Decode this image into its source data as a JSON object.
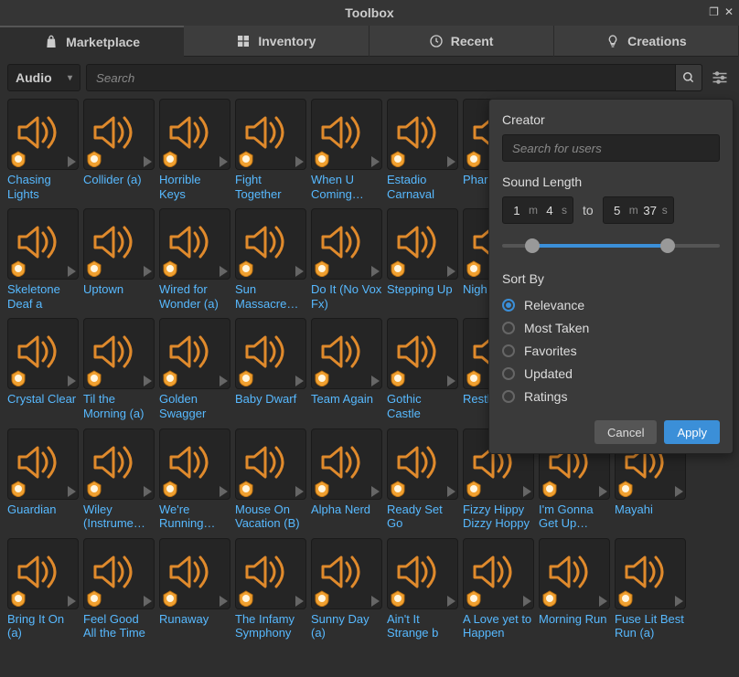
{
  "window": {
    "title": "Toolbox"
  },
  "tabs": [
    {
      "label": "Marketplace",
      "icon": "bag-icon",
      "active": true
    },
    {
      "label": "Inventory",
      "icon": "grid-icon",
      "active": false
    },
    {
      "label": "Recent",
      "icon": "clock-icon",
      "active": false
    },
    {
      "label": "Creations",
      "icon": "bulb-icon",
      "active": false
    }
  ],
  "toolbar": {
    "category": "Audio",
    "search_placeholder": "Search"
  },
  "filter_panel": {
    "creator_label": "Creator",
    "creator_placeholder": "Search for users",
    "length_label": "Sound Length",
    "from": {
      "m": "1",
      "s": "4"
    },
    "to_word": "to",
    "to": {
      "m": "5",
      "s": "37"
    },
    "unit_m": "m",
    "unit_s": "s",
    "sort_label": "Sort By",
    "sort_options": [
      "Relevance",
      "Most Taken",
      "Favorites",
      "Updated",
      "Ratings"
    ],
    "sort_selected": 0,
    "cancel": "Cancel",
    "apply": "Apply",
    "slider": {
      "left_pct": 14,
      "right_pct": 76
    }
  },
  "items": [
    "Chasing Lights",
    "Collider (a)",
    "Horrible Keys",
    "Fight Together",
    "When U Coming…",
    "Estadio Carnaval",
    "Phar…",
    "",
    "",
    "Skeletone Deaf a",
    "Uptown",
    "Wired for Wonder (a)",
    "Sun Massacre…",
    "Do It (No Vox Fx)",
    "Stepping Up",
    "Nigh…",
    "",
    "",
    "Crystal Clear",
    "Til the Morning (a)",
    "Golden Swagger",
    "Baby Dwarf",
    "Team Again",
    "Gothic Castle",
    "Restl…",
    "",
    "",
    "Guardian",
    "Wiley (Instrume…",
    "We're Running…",
    "Mouse On Vacation (B)",
    "Alpha Nerd",
    "Ready Set Go",
    "Fizzy Hippy Dizzy Hoppy",
    "I'm Gonna Get Up…",
    "Mayahi",
    "Bring It On (a)",
    "Feel Good All the Time",
    "Runaway",
    "The Infamy Symphony",
    "Sunny Day (a)",
    "Ain't It Strange b",
    "A Love yet to Happen",
    "Morning Run",
    "Fuse Lit Best Run (a)"
  ],
  "items_present": [
    true,
    true,
    true,
    true,
    true,
    true,
    true,
    false,
    false,
    true,
    true,
    true,
    true,
    true,
    true,
    true,
    false,
    false,
    true,
    true,
    true,
    true,
    true,
    true,
    true,
    false,
    false,
    true,
    true,
    true,
    true,
    true,
    true,
    true,
    true,
    true,
    true,
    true,
    true,
    true,
    true,
    true,
    true,
    true,
    true
  ],
  "colors": {
    "accent": "#3b8fd8",
    "link": "#57b9ff",
    "sound": "#e08a2c"
  }
}
